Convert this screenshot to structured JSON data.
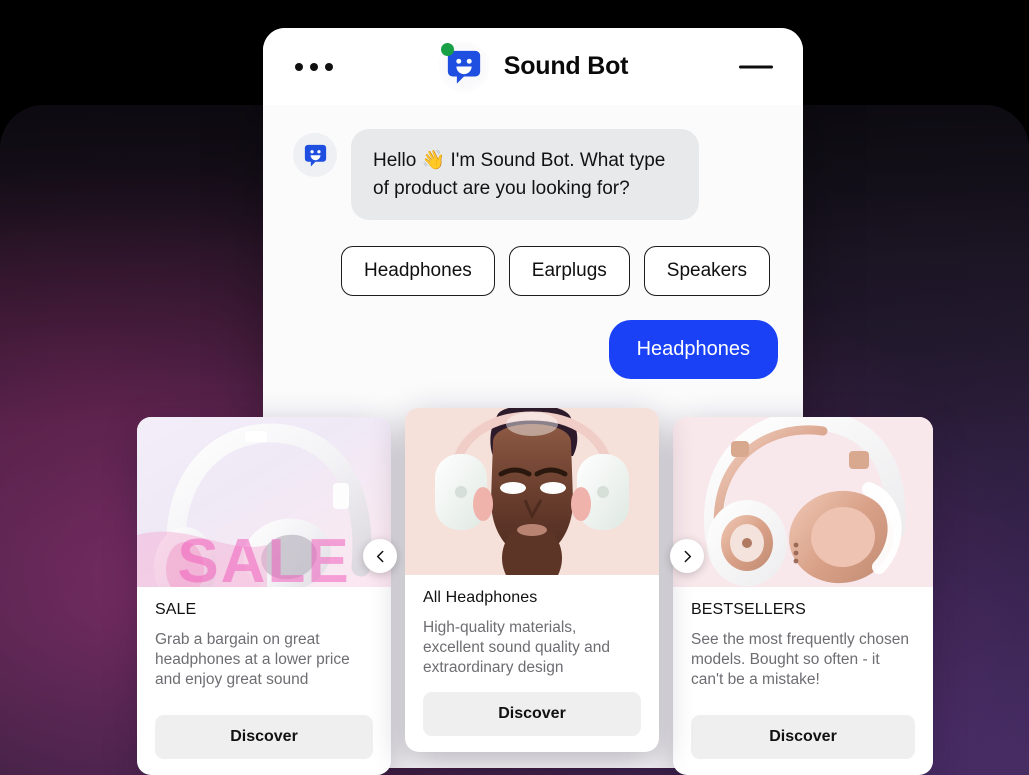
{
  "header": {
    "menu_icon": "three-dots-icon",
    "title": "Sound Bot",
    "status": "online",
    "minimize_label": "—",
    "logo_icon": "chat-bubble-smile-icon"
  },
  "conversation": {
    "bot_message": "Hello 👋  I'm Sound Bot. What type of product are you looking for?",
    "quick_replies": [
      {
        "label": "Headphones"
      },
      {
        "label": "Earplugs"
      },
      {
        "label": "Speakers"
      }
    ],
    "user_message": "Headphones"
  },
  "carousel": {
    "prev_icon": "chevron-left-icon",
    "next_icon": "chevron-right-icon",
    "cards": [
      {
        "title": "SALE",
        "description": "Grab a bargain on great headphones at a lower price and enjoy great sound",
        "cta": "Discover",
        "image_alt": "white-pink-headphones-sale-banner",
        "image_overlay_text": "SALE"
      },
      {
        "title": "All Headphones",
        "description": "High-quality materials, excellent sound quality and extraordinary design",
        "cta": "Discover",
        "image_alt": "woman-wearing-white-pink-headphones"
      },
      {
        "title": "BESTSELLERS",
        "description": "See the most frequently chosen models. Bought so often - it can't be a mistake!",
        "cta": "Discover",
        "image_alt": "rose-gold-white-headphones"
      }
    ]
  },
  "colors": {
    "accent_blue": "#1a41f5",
    "status_green": "#18a047",
    "bot_bubble": "#e8e9eb",
    "cta_bg": "#efeff0",
    "backdrop_purple": "#2e2140"
  }
}
